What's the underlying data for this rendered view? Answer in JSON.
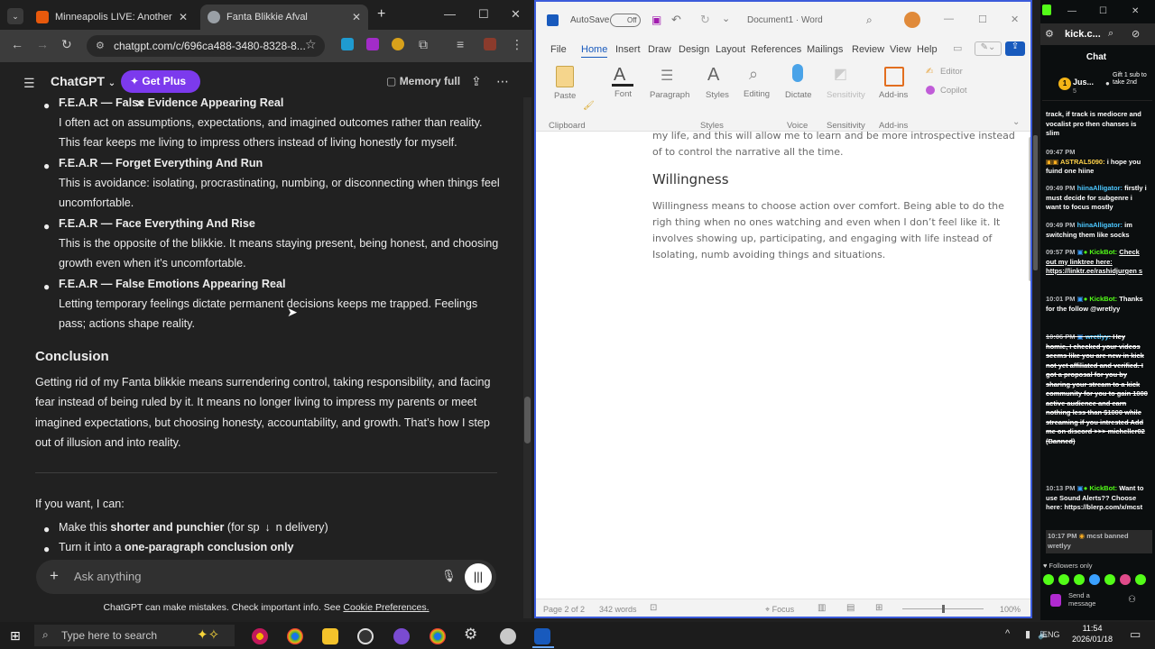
{
  "chrome": {
    "tabs": [
      {
        "label": "Minneapolis LIVE: Another I",
        "fav_color": "#e8590c"
      },
      {
        "label": "Fanta Blikkie Afval",
        "fav_color": "#9aa0a6"
      }
    ],
    "new_tab": "+",
    "url": "chatgpt.com/c/696ca488-3480-8328-8..."
  },
  "chatgpt": {
    "title": "ChatGPT",
    "get_plus": "Get Plus",
    "memory": "Memory full",
    "items": [
      {
        "heading": "F.E.A.R — False Evidence Appearing Real",
        "body": "I often act on assumptions, expectations, and imagined outcomes rather than reality. This fear keeps me living to impress others instead of living honestly for myself."
      },
      {
        "heading": "F.E.A.R — Forget Everything And Run",
        "body": "This is avoidance: isolating, procrastinating, numbing, or disconnecting when things feel uncomfortable."
      },
      {
        "heading": "F.E.A.R — Face Everything And Rise",
        "body": "This is the opposite of the blikkie. It means staying present, being honest, and choosing growth even when it’s uncomfortable."
      },
      {
        "heading": "F.E.A.R — False Emotions Appearing Real",
        "body": "Letting temporary feelings dictate permanent decisions keeps me trapped. Feelings pass; actions shape reality."
      }
    ],
    "conclusion_heading": "Conclusion",
    "conclusion_body": "Getting rid of my Fanta blikkie means surrendering control, taking responsibility, and facing fear instead of being ruled by it. It means no longer living to impress my parents or meet imagined expectations, but choosing honesty, accountability, and growth. That’s how I step out of illusion and into reality.",
    "offer_intro": "If you want, I can:",
    "offer1_prefix": "Make this ",
    "offer1_bold": "shorter and punchier",
    "offer1_suffix": " (for sp",
    "offer1_tail": "n delivery)",
    "offer2_prefix": "Turn it into a ",
    "offer2_bold": "one-paragraph conclusion only",
    "ask_placeholder": "Ask anything",
    "disclaimer": "ChatGPT can make mistakes. Check important info. See ",
    "disclaimer_link": "Cookie Preferences."
  },
  "word": {
    "autosave": "AutoSave",
    "toggle": "Off",
    "doc_title": "Document1 · Word",
    "menu": [
      "File",
      "Home",
      "Insert",
      "Draw",
      "Design",
      "Layout",
      "References",
      "Mailings",
      "Review",
      "View",
      "Help"
    ],
    "ribbon": {
      "paste": "Paste",
      "font": "Font",
      "paragraph": "Paragraph",
      "styles": "Styles",
      "editing": "Editing",
      "dictate": "Dictate",
      "sensitivity": "Sensitivity",
      "addins": "Add-ins",
      "editor": "Editor",
      "copilot": "Copilot",
      "clipboard": "Clipboard",
      "styles_group": "Styles",
      "voice": "Voice",
      "sensitivity_group": "Sensitivity",
      "addins_group": "Add-ins"
    },
    "body_top": "my life, and this will allow me to learn and be more introspective instead of to control the narrative all the time.",
    "heading": "Willingness",
    "body": "Willingness means to choose action over comfort. Being able to do the righ thing when no ones watching and even when I don’t feel like it. It involves showing up, participating, and engaging with life instead of Isolating, numb avoiding things and situations.",
    "page": "Page 2 of 2",
    "words": "342 words",
    "focus": "Focus",
    "zoom": "100%"
  },
  "kick": {
    "url": "kick.c...",
    "chat": "Chat",
    "pinned_user": "Jus...",
    "pinned_count": "5",
    "gift": "Gift 1 sub to take 2nd",
    "messages": [
      {
        "time": "",
        "user": "",
        "text": "track, if track is mediocre and vocalist pro then chanses is slim",
        "cls": ""
      },
      {
        "time": "09:47 PM",
        "user": "ASTRAL5090:",
        "text": "i hope you fuind one hiine",
        "cls": "kgold"
      },
      {
        "time": "09:49 PM",
        "user": "hiinaAlligator:",
        "text": "firstly i must decide for subgenre i want to focus mostly",
        "cls": "kuser"
      },
      {
        "time": "09:49 PM",
        "user": "hiinaAlligator:",
        "text": "im switching them like socks",
        "cls": "kuser"
      },
      {
        "time": "09:57 PM",
        "user": "KickBot:",
        "text": "Check out my linktree here: https://linktr.ee/rashidjurgen s",
        "cls": "kbot"
      },
      {
        "time": "10:01 PM",
        "user": "KickBot:",
        "text": "Thanks for the follow @wretlyy",
        "cls": "kbot"
      },
      {
        "time": "10:06 PM",
        "user": "wretlyy:",
        "text": "Hey homie, I checked your videos seems like you are new in kick not yet affiliated and verified. I got a proposal for you by sharing your stream to a kick community for you to gain 1000 active audience and earn nothing less than $1000 while streaming if you intrested Add me on discord >>> micheller02 (Banned)",
        "cls": "kuser"
      },
      {
        "time": "10:13 PM",
        "user": "KickBot:",
        "text": "Want to use Sound Alerts?? Choose here: https://blerp.com/x/mcst",
        "cls": "kbot"
      },
      {
        "time": "10:17 PM",
        "user": "mcst banned",
        "text": "wretlyy",
        "cls": "kgold"
      }
    ],
    "followers_only": "Followers only",
    "send_placeholder": "Send a message"
  },
  "taskbar": {
    "search_placeholder": "Type here to search",
    "lang": "ENG",
    "time": "11:54",
    "date": "2026/01/18"
  }
}
